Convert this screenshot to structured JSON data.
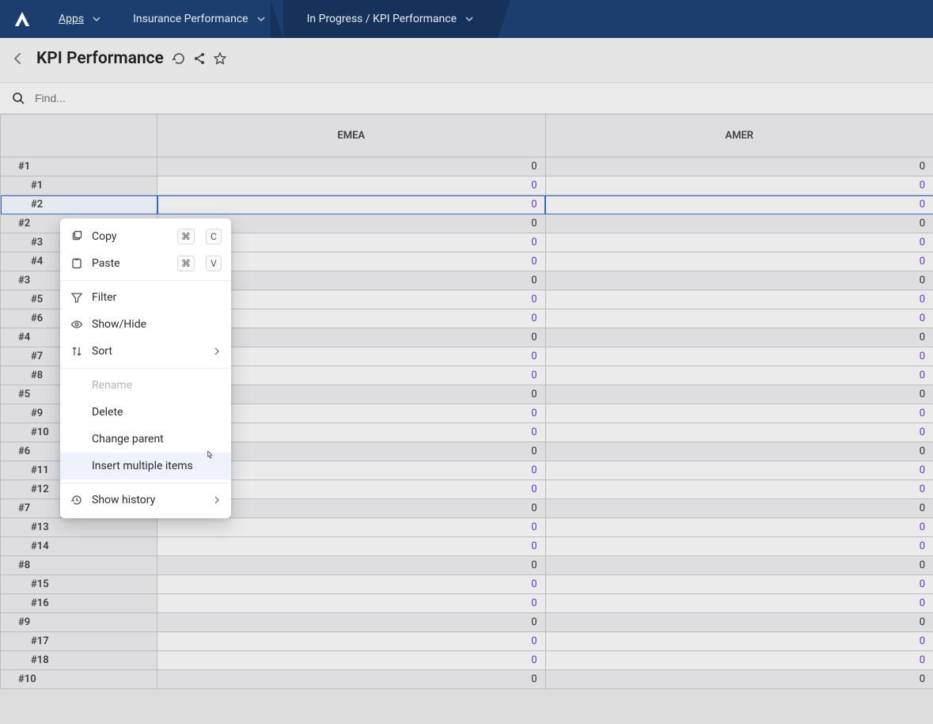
{
  "nav": {
    "apps_label": "Apps",
    "workspace_label": "Insurance Performance",
    "crumb_label": "In Progress / KPI Performance"
  },
  "header": {
    "title": "KPI Performance"
  },
  "search": {
    "placeholder": "Find..."
  },
  "columns": [
    "EMEA",
    "AMER"
  ],
  "rows": [
    {
      "label": "#1",
      "level": 0,
      "emea": "0",
      "amer": "0"
    },
    {
      "label": "#1",
      "level": 1,
      "emea": "0",
      "amer": "0"
    },
    {
      "label": "#2",
      "level": 1,
      "emea": "0",
      "amer": "0",
      "selected": true
    },
    {
      "label": "#2",
      "level": 0,
      "emea": "0",
      "amer": "0"
    },
    {
      "label": "#3",
      "level": 1,
      "emea": "0",
      "amer": "0"
    },
    {
      "label": "#4",
      "level": 1,
      "emea": "0",
      "amer": "0"
    },
    {
      "label": "#3",
      "level": 0,
      "emea": "0",
      "amer": "0"
    },
    {
      "label": "#5",
      "level": 1,
      "emea": "0",
      "amer": "0"
    },
    {
      "label": "#6",
      "level": 1,
      "emea": "0",
      "amer": "0"
    },
    {
      "label": "#4",
      "level": 0,
      "emea": "0",
      "amer": "0"
    },
    {
      "label": "#7",
      "level": 1,
      "emea": "0",
      "amer": "0"
    },
    {
      "label": "#8",
      "level": 1,
      "emea": "0",
      "amer": "0"
    },
    {
      "label": "#5",
      "level": 0,
      "emea": "0",
      "amer": "0"
    },
    {
      "label": "#9",
      "level": 1,
      "emea": "0",
      "amer": "0"
    },
    {
      "label": "#10",
      "level": 1,
      "emea": "0",
      "amer": "0"
    },
    {
      "label": "#6",
      "level": 0,
      "emea": "0",
      "amer": "0"
    },
    {
      "label": "#11",
      "level": 1,
      "emea": "0",
      "amer": "0"
    },
    {
      "label": "#12",
      "level": 1,
      "emea": "0",
      "amer": "0"
    },
    {
      "label": "#7",
      "level": 0,
      "emea": "0",
      "amer": "0"
    },
    {
      "label": "#13",
      "level": 1,
      "emea": "0",
      "amer": "0"
    },
    {
      "label": "#14",
      "level": 1,
      "emea": "0",
      "amer": "0"
    },
    {
      "label": "#8",
      "level": 0,
      "emea": "0",
      "amer": "0"
    },
    {
      "label": "#15",
      "level": 1,
      "emea": "0",
      "amer": "0"
    },
    {
      "label": "#16",
      "level": 1,
      "emea": "0",
      "amer": "0"
    },
    {
      "label": "#9",
      "level": 0,
      "emea": "0",
      "amer": "0"
    },
    {
      "label": "#17",
      "level": 1,
      "emea": "0",
      "amer": "0"
    },
    {
      "label": "#18",
      "level": 1,
      "emea": "0",
      "amer": "0"
    },
    {
      "label": "#10",
      "level": 0,
      "emea": "0",
      "amer": "0"
    }
  ],
  "context_menu": {
    "copy": "Copy",
    "paste": "Paste",
    "filter": "Filter",
    "show_hide": "Show/Hide",
    "sort": "Sort",
    "rename": "Rename",
    "delete": "Delete",
    "change_parent": "Change parent",
    "insert_multiple": "Insert multiple items",
    "show_history": "Show history",
    "shortcut_cmd": "⌘",
    "shortcut_c": "C",
    "shortcut_v": "V"
  }
}
